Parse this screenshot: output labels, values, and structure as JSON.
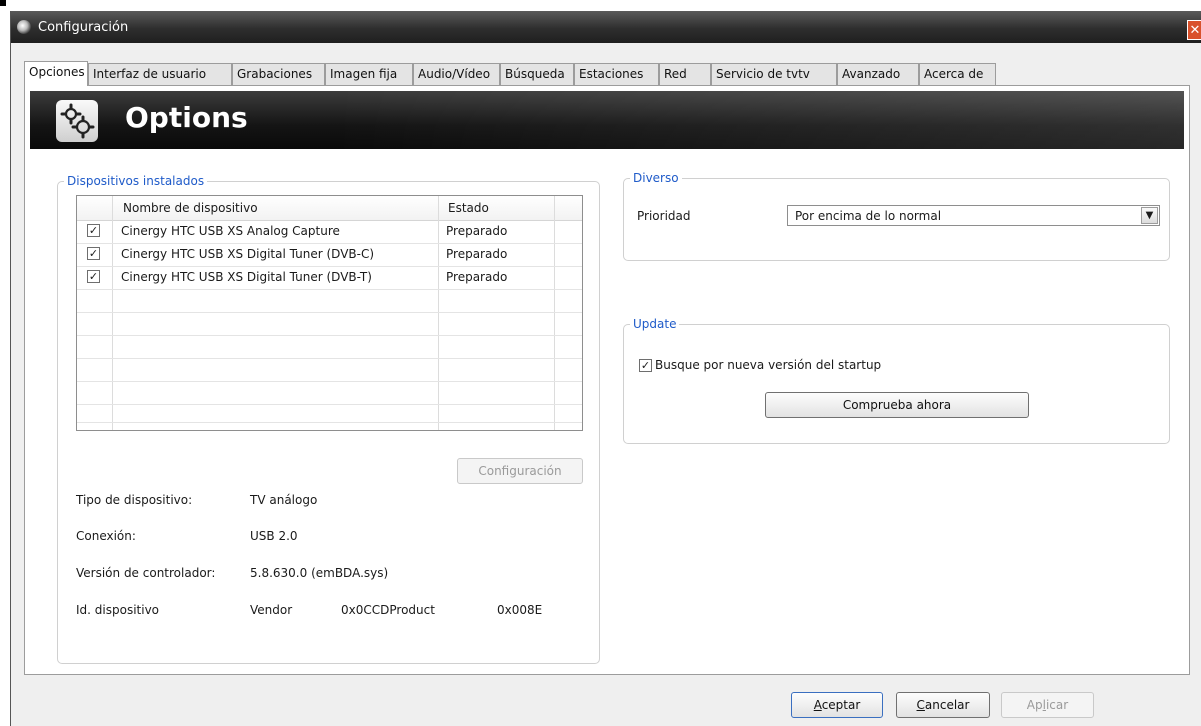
{
  "window": {
    "title": "Configuración",
    "close_glyph": "✕"
  },
  "tabs": [
    {
      "label": "Opciones",
      "active": true
    },
    {
      "label": "Interfaz de usuario"
    },
    {
      "label": "Grabaciones"
    },
    {
      "label": "Imagen fija"
    },
    {
      "label": "Audio/Vídeo"
    },
    {
      "label": "Búsqueda"
    },
    {
      "label": "Estaciones"
    },
    {
      "label": "Red"
    },
    {
      "label": "Servicio de tvtv"
    },
    {
      "label": "Avanzado"
    },
    {
      "label": "Acerca de"
    }
  ],
  "banner": {
    "title": "Options",
    "icon": "gears-icon"
  },
  "devices": {
    "legend": "Dispositivos instalados",
    "columns": [
      "Nombre de dispositivo",
      "Estado"
    ],
    "rows": [
      {
        "checked": true,
        "name": "Cinergy HTC USB XS Analog Capture",
        "state": "Preparado"
      },
      {
        "checked": true,
        "name": "Cinergy HTC USB XS Digital Tuner (DVB-C)",
        "state": "Preparado"
      },
      {
        "checked": true,
        "name": "Cinergy HTC USB XS Digital Tuner (DVB-T)",
        "state": "Preparado"
      }
    ],
    "config_button": "Configuración",
    "info": {
      "type_label": "Tipo de dispositivo:",
      "type_value": "TV análogo",
      "conn_label": "Conexión:",
      "conn_value": "USB 2.0",
      "driver_label": "Versión de controlador:",
      "driver_value": "5.8.630.0 (emBDA.sys)",
      "id_label": "Id. dispositivo",
      "vendor_label": "Vendor",
      "vendor_value": "0x0CCDProduct",
      "product_value": "0x008E"
    }
  },
  "diverso": {
    "legend": "Diverso",
    "priority_label": "Prioridad",
    "priority_value": "Por encima de lo normal"
  },
  "update": {
    "legend": "Update",
    "checkbox_label": "Busque por nueva versión del startup",
    "checked": true,
    "check_now_button": "Comprueba ahora"
  },
  "footer": {
    "accept_first": "A",
    "accept_rest": "ceptar",
    "cancel_first": "C",
    "cancel_rest": "ancelar",
    "apply_pre": "Ap",
    "apply_u": "l",
    "apply_rest": "icar"
  },
  "colors": {
    "legend_blue": "#1f5bc9",
    "close_red": "#d9512c",
    "titlebar": "#2e2e2e"
  }
}
